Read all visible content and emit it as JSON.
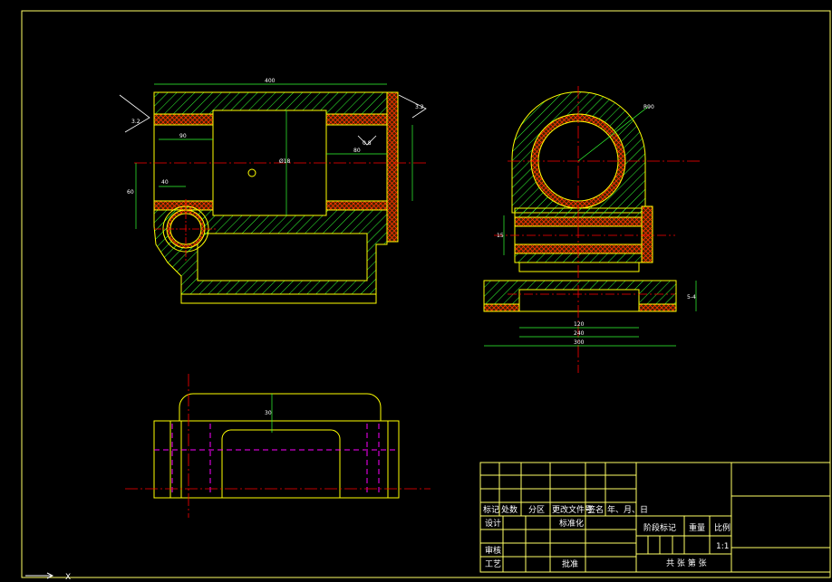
{
  "drawing": {
    "colors": {
      "background": "#000000",
      "outline": "#ffff00",
      "hatch": "#33ff33",
      "crosshatch": "#ff3300",
      "centerline": "#ff0000",
      "hidden": "#ff00ff",
      "dimension": "#33ff33",
      "frame": "#ffff66",
      "text": "#ffffff"
    },
    "view_front": {
      "dims": {
        "top": "400",
        "left_bore": "90",
        "left_height": "60",
        "small_bore": "40",
        "center_height": "Ø18",
        "right_offset": "80",
        "roughness_left": "3.2",
        "roughness_right": "3.2",
        "roughness_mid": "0.8"
      }
    },
    "view_side": {
      "dims": {
        "radius": "R90",
        "vert": "15",
        "base_w1": "120",
        "base_w2": "240",
        "base_w3": "300",
        "base_h": "5-4"
      }
    },
    "view_top": {
      "dims": {
        "height": "30"
      }
    },
    "axis_label": "X"
  },
  "title_block": {
    "header": [
      "标记",
      "处数",
      "分区",
      "更改文件号",
      "签名",
      "年、月、日"
    ],
    "row_design": "设计",
    "row_standard": "标准化",
    "row_review": "审核",
    "row_process": "工艺",
    "row_approve": "批准",
    "stage_mark": "阶段标记",
    "weight": "重量",
    "scale": "比例",
    "scale_value": "1:1",
    "sheets": "共  张  第  张"
  }
}
